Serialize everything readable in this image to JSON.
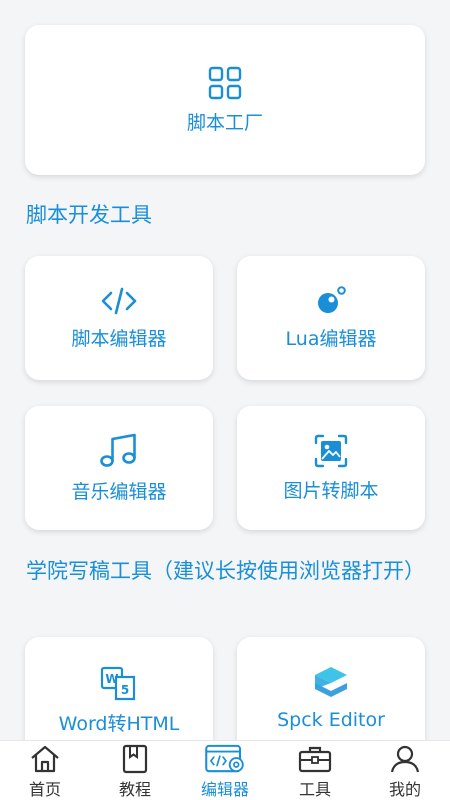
{
  "top_card": {
    "label": "脚本工厂",
    "icon": "grid-icon"
  },
  "sections": [
    {
      "title": "脚本开发工具",
      "items": [
        {
          "label": "脚本编辑器",
          "icon": "code-icon"
        },
        {
          "label": "Lua编辑器",
          "icon": "lua-icon"
        },
        {
          "label": "音乐编辑器",
          "icon": "music-note-icon"
        },
        {
          "label": "图片转脚本",
          "icon": "image-frame-icon"
        }
      ]
    },
    {
      "title": "学院写稿工具（建议长按使用浏览器打开）",
      "items": [
        {
          "label": "Word转HTML",
          "icon": "word-html-icon"
        },
        {
          "label": "Spck Editor",
          "icon": "spck-logo-icon"
        }
      ]
    }
  ],
  "bottom_nav": [
    {
      "label": "首页",
      "icon": "home-icon",
      "active": false
    },
    {
      "label": "教程",
      "icon": "book-icon",
      "active": false
    },
    {
      "label": "编辑器",
      "icon": "editor-gear-icon",
      "active": true
    },
    {
      "label": "工具",
      "icon": "toolbox-icon",
      "active": false
    },
    {
      "label": "我的",
      "icon": "user-icon",
      "active": false
    }
  ],
  "colors": {
    "accent": "#1a8fd8",
    "background": "#f4f5f7",
    "card": "#ffffff",
    "nav_text": "#333333"
  }
}
